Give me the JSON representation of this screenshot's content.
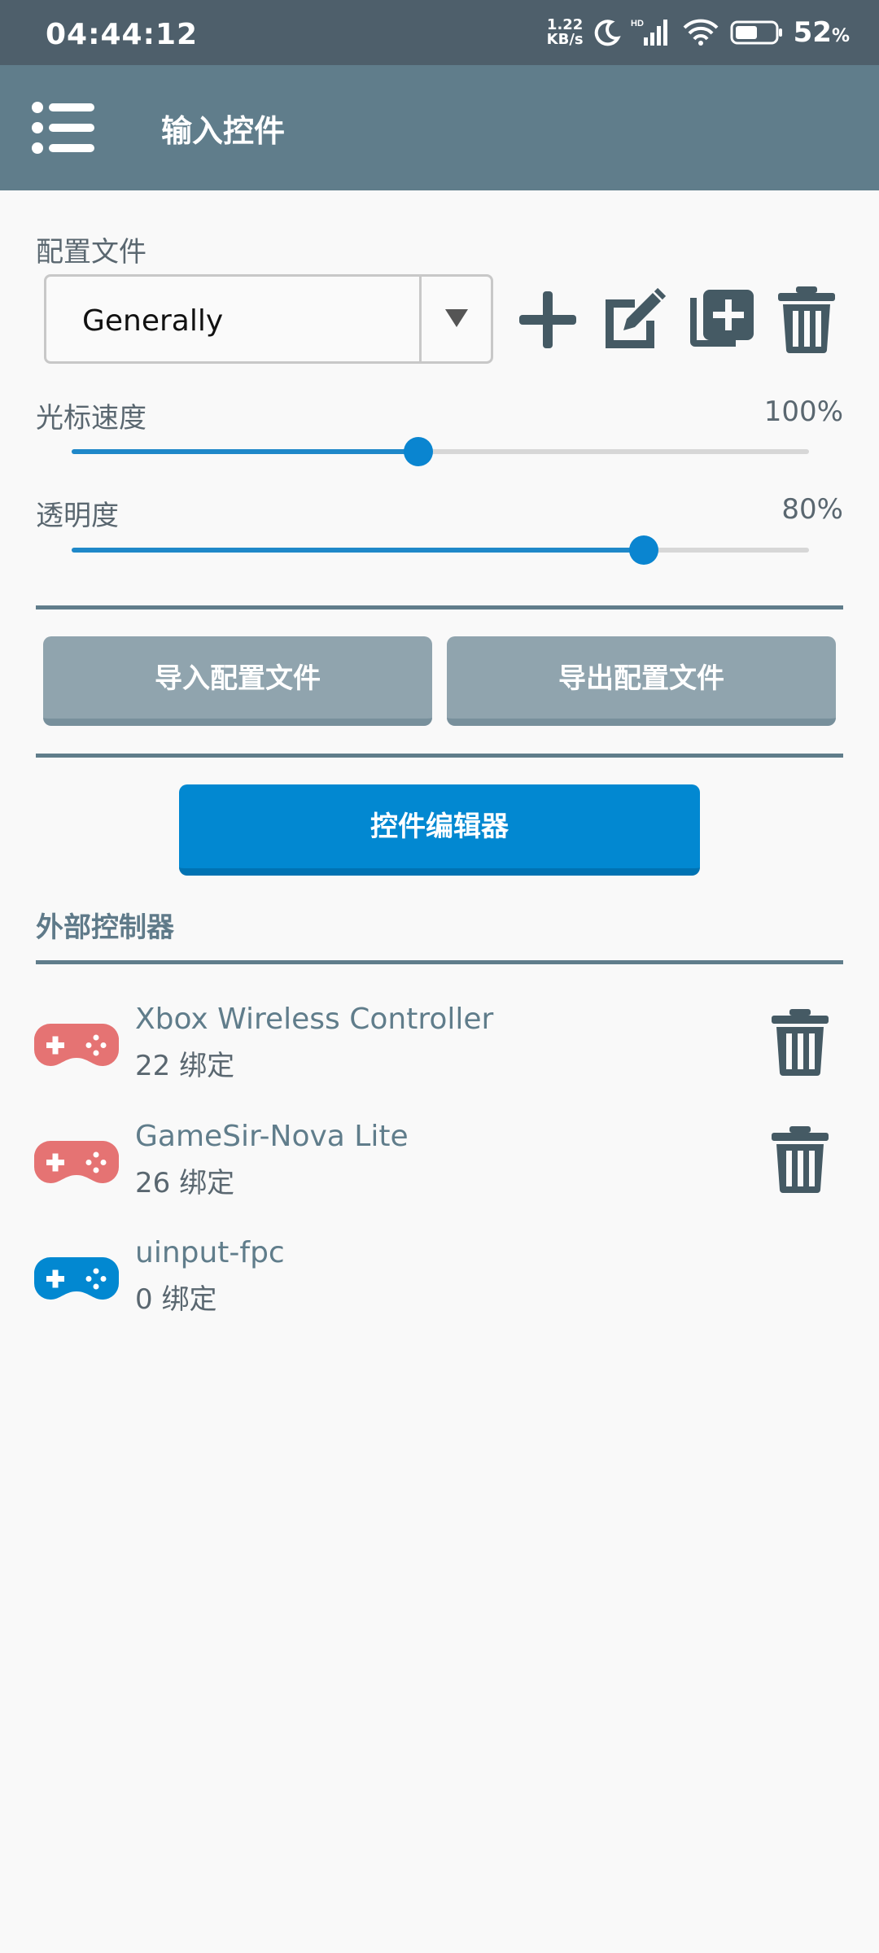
{
  "status_bar": {
    "time": "04:44:12",
    "net_speed_value": "1.22",
    "net_speed_unit": "KB/s",
    "hd_label": "HD",
    "battery_percent": "52",
    "battery_sign": "%"
  },
  "app_bar": {
    "title": "输入控件"
  },
  "profile": {
    "label": "配置文件",
    "selected": "Generally"
  },
  "sliders": [
    {
      "label": "光标速度",
      "value_text": "100%",
      "position": 0.47
    },
    {
      "label": "透明度",
      "value_text": "80%",
      "position": 0.776
    }
  ],
  "buttons": {
    "import": "导入配置文件",
    "export": "导出配置文件",
    "editor": "控件编辑器"
  },
  "external": {
    "title": "外部控制器",
    "controllers": [
      {
        "name": "Xbox Wireless Controller",
        "bindings": "22 绑定",
        "icon_color": "#e57373",
        "deletable": true
      },
      {
        "name": "GameSir-Nova Lite",
        "bindings": "26 绑定",
        "icon_color": "#e57373",
        "deletable": true
      },
      {
        "name": "uinput-fpc",
        "bindings": "0 绑定",
        "icon_color": "#0288d1",
        "deletable": false
      }
    ]
  },
  "colors": {
    "app_bar": "#607d8b",
    "status_bar": "#4e5f6b",
    "accent": "#0288d1",
    "grey_button": "#90a4ae",
    "icon": "#455a64"
  },
  "icons": {
    "menu": "menu-list-icon",
    "add": "plus-icon",
    "edit": "edit-icon",
    "duplicate": "duplicate-icon",
    "delete": "trash-icon",
    "gamepad": "gamepad-icon"
  }
}
